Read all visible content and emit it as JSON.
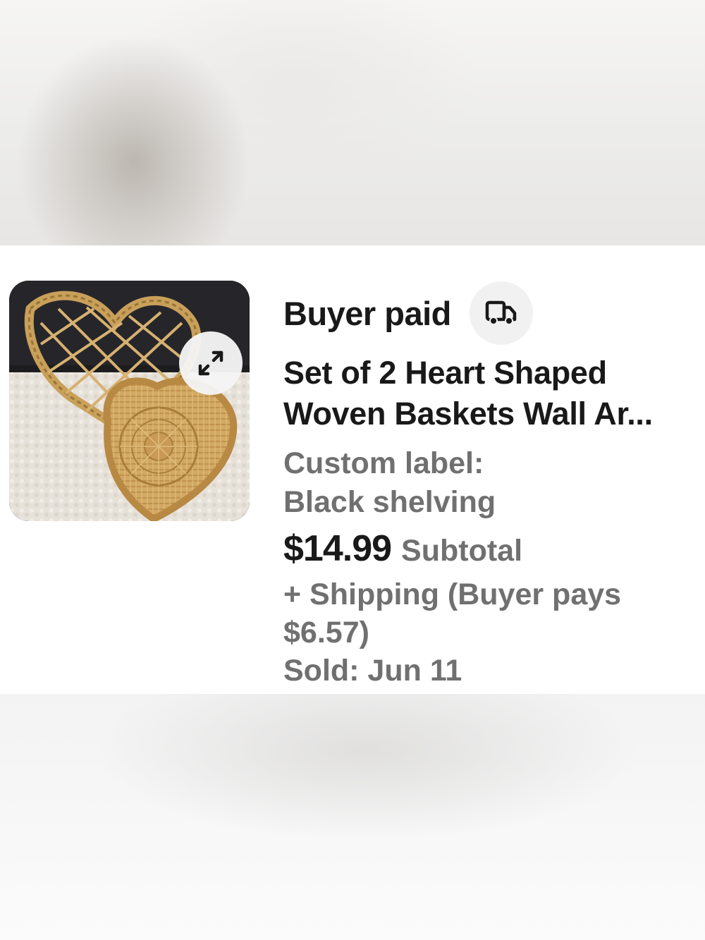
{
  "order": {
    "status": "Buyer paid",
    "status_icon": "truck-icon",
    "title": "Set of 2 Heart Shaped Woven Baskets Wall Ar...",
    "custom_label_heading": "Custom label:",
    "custom_label_value": "Black shelving",
    "price": "$14.99",
    "price_suffix": "Subtotal",
    "shipping_line1": "+ Shipping (Buyer pays",
    "shipping_line2": "$6.57)",
    "sold": "Sold: Jun 11"
  },
  "thumbnail": {
    "expand_icon": "expand-arrows-icon",
    "colors": {
      "wicker": "#c9a05a",
      "wicker_dark": "#9a7437",
      "background": "#1d1d1f",
      "fabric": "#e9e4dc"
    }
  }
}
